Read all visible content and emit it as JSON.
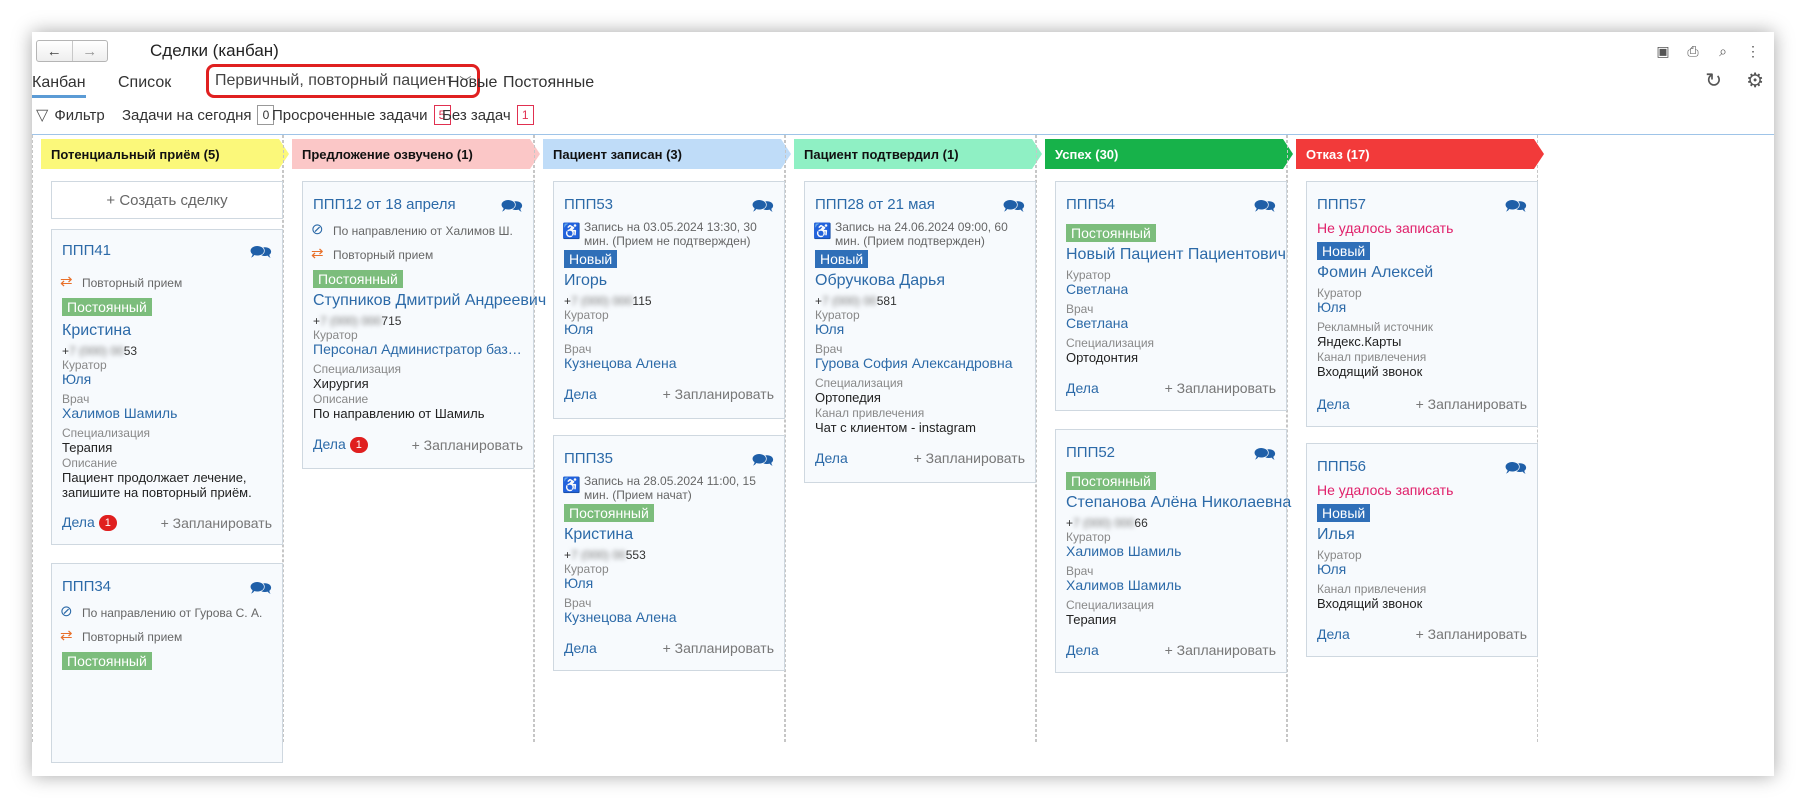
{
  "window": {
    "title": "Сделки (канбан)",
    "nav_back": "←",
    "nav_forward": "→"
  },
  "views": {
    "kanban": "Канбан",
    "list": "Список",
    "dropdown_value": "Первичный, повторный пациент",
    "quick_new": "Новые",
    "quick_permanent": "Постоянные"
  },
  "filters": {
    "filter_label": "Фильтр",
    "today_label": "Задачи на сегодня",
    "today_count": "0",
    "overdue_label": "Просроченные задачи",
    "overdue_count": "5",
    "notasks_label": "Без задач",
    "notasks_count": "1"
  },
  "columns": [
    {
      "title": "Потенциальный приём (5)",
      "color": "#fbf87a"
    },
    {
      "title": "Предложение озвучено (1)",
      "color": "#fbc7c7"
    },
    {
      "title": "Пациент записан (3)",
      "color": "#bfdcf8"
    },
    {
      "title": "Пациент подтвердил (1)",
      "color": "#8ff0c4"
    },
    {
      "title": "Успех (30)",
      "color": "#17b24a"
    },
    {
      "title": "Отказ (17)",
      "color": "#f23a3a"
    }
  ],
  "common": {
    "create_deal": "+ Создать сделку",
    "deals": "Дела",
    "plan": "+ Запланировать",
    "curator": "Куратор",
    "doctor": "Врач",
    "specialization": "Специализация",
    "description": "Описание",
    "channel": "Канал привлечения",
    "ad_source": "Рекламный источник",
    "repeat": "Повторный прием",
    "badge_permanent": "Постоянный",
    "badge_new": "Новый",
    "failed": "Не удалось записать"
  },
  "cards": {
    "c41": {
      "title": "ППП41",
      "name": "Кристина",
      "phone_a": "+",
      "phone_blur": "7 (000) 00",
      "phone_b": "53",
      "curator": "Юля",
      "doctor": "Халимов Шамиль",
      "spec": "Терапия",
      "desc": "Пациент продолжает лечение, запишите на повторный приём.",
      "deals_count": "1"
    },
    "c34": {
      "title": "ППП34",
      "referral": "По направлению от Гурова С. А."
    },
    "c12": {
      "title": "ППП12 от 18 апреля",
      "referral": "По направлению от Халимов Ш.",
      "name": "Ступников Дмитрий Андреевич",
      "phone_a": "+",
      "phone_blur": "7 (000) 000",
      "phone_b": "715",
      "curator": "Персонал Администратор базы да...",
      "spec": "Хирургия",
      "desc": "По направлению от Шамиль",
      "deals_count": "1"
    },
    "c53": {
      "title": "ППП53",
      "appt": "Запись на 03.05.2024 13:30, 30 мин. (Прием не подтвержден)",
      "name": "Игорь",
      "phone_a": "+",
      "phone_blur": "7 (000) 000",
      "phone_b": "115",
      "curator": "Юля",
      "doctor": "Кузнецова Алена"
    },
    "c35": {
      "title": "ППП35",
      "appt": "Запись на 28.05.2024 11:00, 15 мин. (Прием начат)",
      "name": "Кристина",
      "phone_a": "+",
      "phone_blur": "7 (000) 00",
      "phone_b": "553",
      "curator": "Юля",
      "doctor": "Кузнецова Алена"
    },
    "c28": {
      "title": "ППП28 от 21 мая",
      "appt": "Запись на 24.06.2024 09:00, 60 мин. (Прием подтвержден)",
      "name": "Обручкова Дарья",
      "phone_a": "+",
      "phone_blur": "7 (000) 00",
      "phone_b": "581",
      "curator": "Юля",
      "doctor": "Гурова София Александровна",
      "spec": "Ортопедия",
      "channel": "Чат с клиентом - instagram"
    },
    "c54": {
      "title": "ППП54",
      "name": "Новый Пациент Пациентович",
      "curator": "Светлана",
      "doctor": "Светлана",
      "spec": "Ортодонтия"
    },
    "c52": {
      "title": "ППП52",
      "name": "Степанова Алёна Николаевна",
      "phone_a": "+",
      "phone_blur": "7 (000) 000",
      "phone_b": "66",
      "curator": "Халимов Шамиль",
      "doctor": "Халимов Шамиль",
      "spec": "Терапия"
    },
    "c57": {
      "title": "ППП57",
      "name": "Фомин Алексей",
      "curator": "Юля",
      "ad_source": "Яндекс.Карты",
      "channel": "Входящий звонок"
    },
    "c56": {
      "title": "ППП56",
      "name": "Илья",
      "curator": "Юля",
      "channel": "Входящий звонок"
    }
  }
}
